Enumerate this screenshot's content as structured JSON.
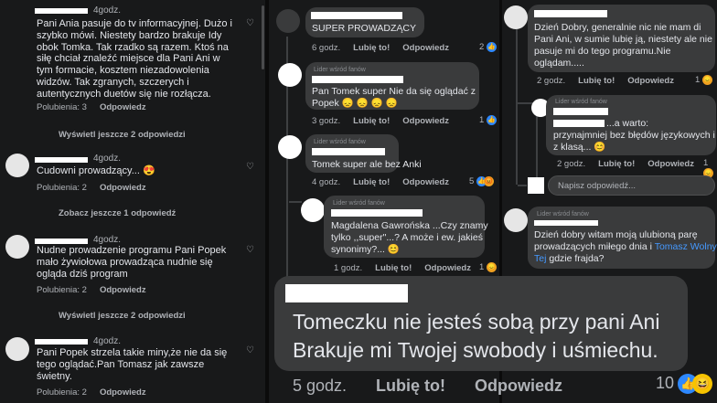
{
  "left": {
    "c1": {
      "time": "4godz.",
      "text": "Pani Ania pasuje do tv informacyjnej. Dużo i\nszybko mówi. Niestety bardzo brakuje Idy\nobok Tomka. Tak rzadko są razem. Ktoś na\nsiłę chciał znaleźć miejsce dla Pani Ani w\ntym formacie, kosztem niezadowolenia\nwidzów. Tak zgranych, szczerych i\nautentycznych duetów się nie rozłącza.",
      "likes": "Polubienia: 3",
      "reply": "Odpowiedz",
      "more": "Wyświetl jeszcze 2 odpowiedzi"
    },
    "c2": {
      "time": "4godz.",
      "text": "Cudowni prowadzący... 😍",
      "likes": "Polubienia: 2",
      "reply": "Odpowiedz",
      "more": "Zobacz jeszcze 1 odpowiedź"
    },
    "c3": {
      "time": "4godz.",
      "text": "Nudne prowadzenie programu Pani Popek\nmało żywiołowa prowadząca nudnie się\nogląda dziś program",
      "likes": "Polubienia: 2",
      "reply": "Odpowiedz",
      "more": "Wyświetl jeszcze 2 odpowiedzi"
    },
    "c4": {
      "time": "4godz.",
      "text": "Pani Popek strzela takie miny,że nie da się\ntego oglądać.Pan Tomasz jak zawsze\nświetny.",
      "likes": "Polubienia: 2",
      "reply": "Odpowiedz"
    }
  },
  "mid": {
    "badge": "Lider wśród fanów",
    "m1": {
      "text": "SUPER PROWADZĄCY",
      "time": "6 godz.",
      "like": "Lubię to!",
      "reply": "Odpowiedz",
      "count": "2"
    },
    "m2": {
      "text": "Pan Tomek super Nie da się oglądać z\nPopek 😞 😞 😞 😞",
      "time": "3 godz.",
      "like": "Lubię to!",
      "reply": "Odpowiedz",
      "count": "1"
    },
    "m3": {
      "text": "Tomek super ale bez Anki",
      "time": "4 godz.",
      "like": "Lubię to!",
      "reply": "Odpowiedz",
      "count": "5"
    },
    "m4": {
      "text": "Magdalena Gawrońska ...Czy znamy\ntylko ,,super\"...? A może i ew. jakieś\nsynonimy?... 😊",
      "time": "1 godz.",
      "like": "Lubię to!",
      "reply": "Odpowiedz",
      "count": "1"
    }
  },
  "right": {
    "badge": "Lider wśród fanów",
    "r1": {
      "text": "Dzień Dobry, generalnie nic nie mam di\nPani Ani, w sumie lubię ją, niestety ale nie\npasuje mi do tego programu.Nie\noglądam.....",
      "time": "2 godz.",
      "like": "Lubię to!",
      "reply": "Odpowiedz",
      "count": "1"
    },
    "r2": {
      "text": "...a warto:\nprzynajmniej bez błędów językowych i\nz klasą... 😊",
      "time": "2 godz.",
      "like": "Lubię to!",
      "reply": "Odpowiedz",
      "count": "1"
    },
    "input_placeholder": "Napisz odpowiedź...",
    "r3": {
      "text_a": "Dzień dobry witam moją ulubioną parę\nprowadzących miłego dnia i ",
      "link": "Tomasz Wolny\nTej",
      "text_b": " gdzie frajda?"
    }
  },
  "big": {
    "text": "Tomeczku nie jesteś sobą przy pani Ani\nBrakuje mi Twojej swobody i uśmiechu.",
    "time": "5 godz.",
    "like": "Lubię to!",
    "reply": "Odpowiedz",
    "count": "10"
  }
}
